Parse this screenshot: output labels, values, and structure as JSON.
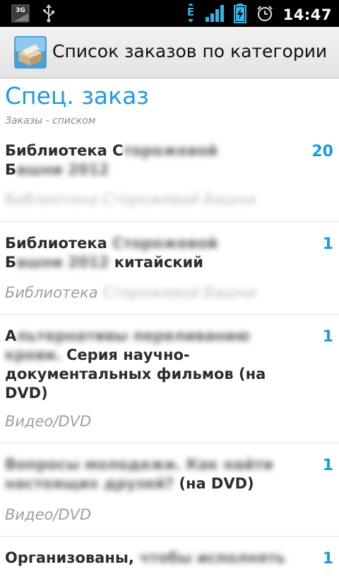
{
  "status_bar": {
    "network_label": "3G",
    "network_type_label": "E",
    "time": "14:47",
    "icons": [
      "3g-signal-icon",
      "usb-icon",
      "data-e-icon",
      "signal-bars-icon",
      "battery-charging-icon",
      "alarm-icon"
    ]
  },
  "app": {
    "title": "Список заказов по категории",
    "icon": "box-icon"
  },
  "section": {
    "title": "Спец. заказ",
    "subtitle": "Заказы - списком"
  },
  "orders": [
    {
      "title_line1_visible": "Библиотека С",
      "title_line1_blurred": "торожевой",
      "title_line2_visible": "Б",
      "title_line2_blurred": "ашни 2012",
      "title_line2_tail": "",
      "count": "20",
      "category_visible": "",
      "category_blurred": "Библиотека Сторожевой Башни"
    },
    {
      "title_line1_visible": "Библиотека",
      "title_line1_blurred": " Сторожевой",
      "title_line2_visible": "Б",
      "title_line2_blurred": "ашни 2012",
      "title_line2_tail": " китайский",
      "count": "1",
      "category_visible": "Библиотека ",
      "category_blurred": "Сторожевой Башни"
    },
    {
      "title_line1_visible": "А",
      "title_line1_blurred": "льтернативы переливанию",
      "title_line2_visible": "",
      "title_line2_blurred": "крови.",
      "title_line2_tail": " Серия научно-",
      "title_line3": "документальных фильмов (на",
      "title_line4": "DVD)",
      "count": "1",
      "category_visible": "Видео/DVD",
      "category_blurred": ""
    },
    {
      "title_line1_visible": "",
      "title_line1_blurred": "Вопросы молодежи. Как найти",
      "title_line2_visible": "",
      "title_line2_blurred": "настоящих друзей?",
      "title_line2_tail": " (на DVD)",
      "count": "1",
      "category_visible": "Видео/DVD",
      "category_blurred": ""
    },
    {
      "title_line1_visible": "Организованы,",
      "title_line1_blurred": " чтобы исполнять",
      "count": "1"
    }
  ],
  "colors": {
    "accent": "#1e9ae0",
    "title_text": "#2d2d2d",
    "category_text": "#9e9e9e",
    "status_bar": "#000000",
    "signal_green": "#33b5e5"
  }
}
